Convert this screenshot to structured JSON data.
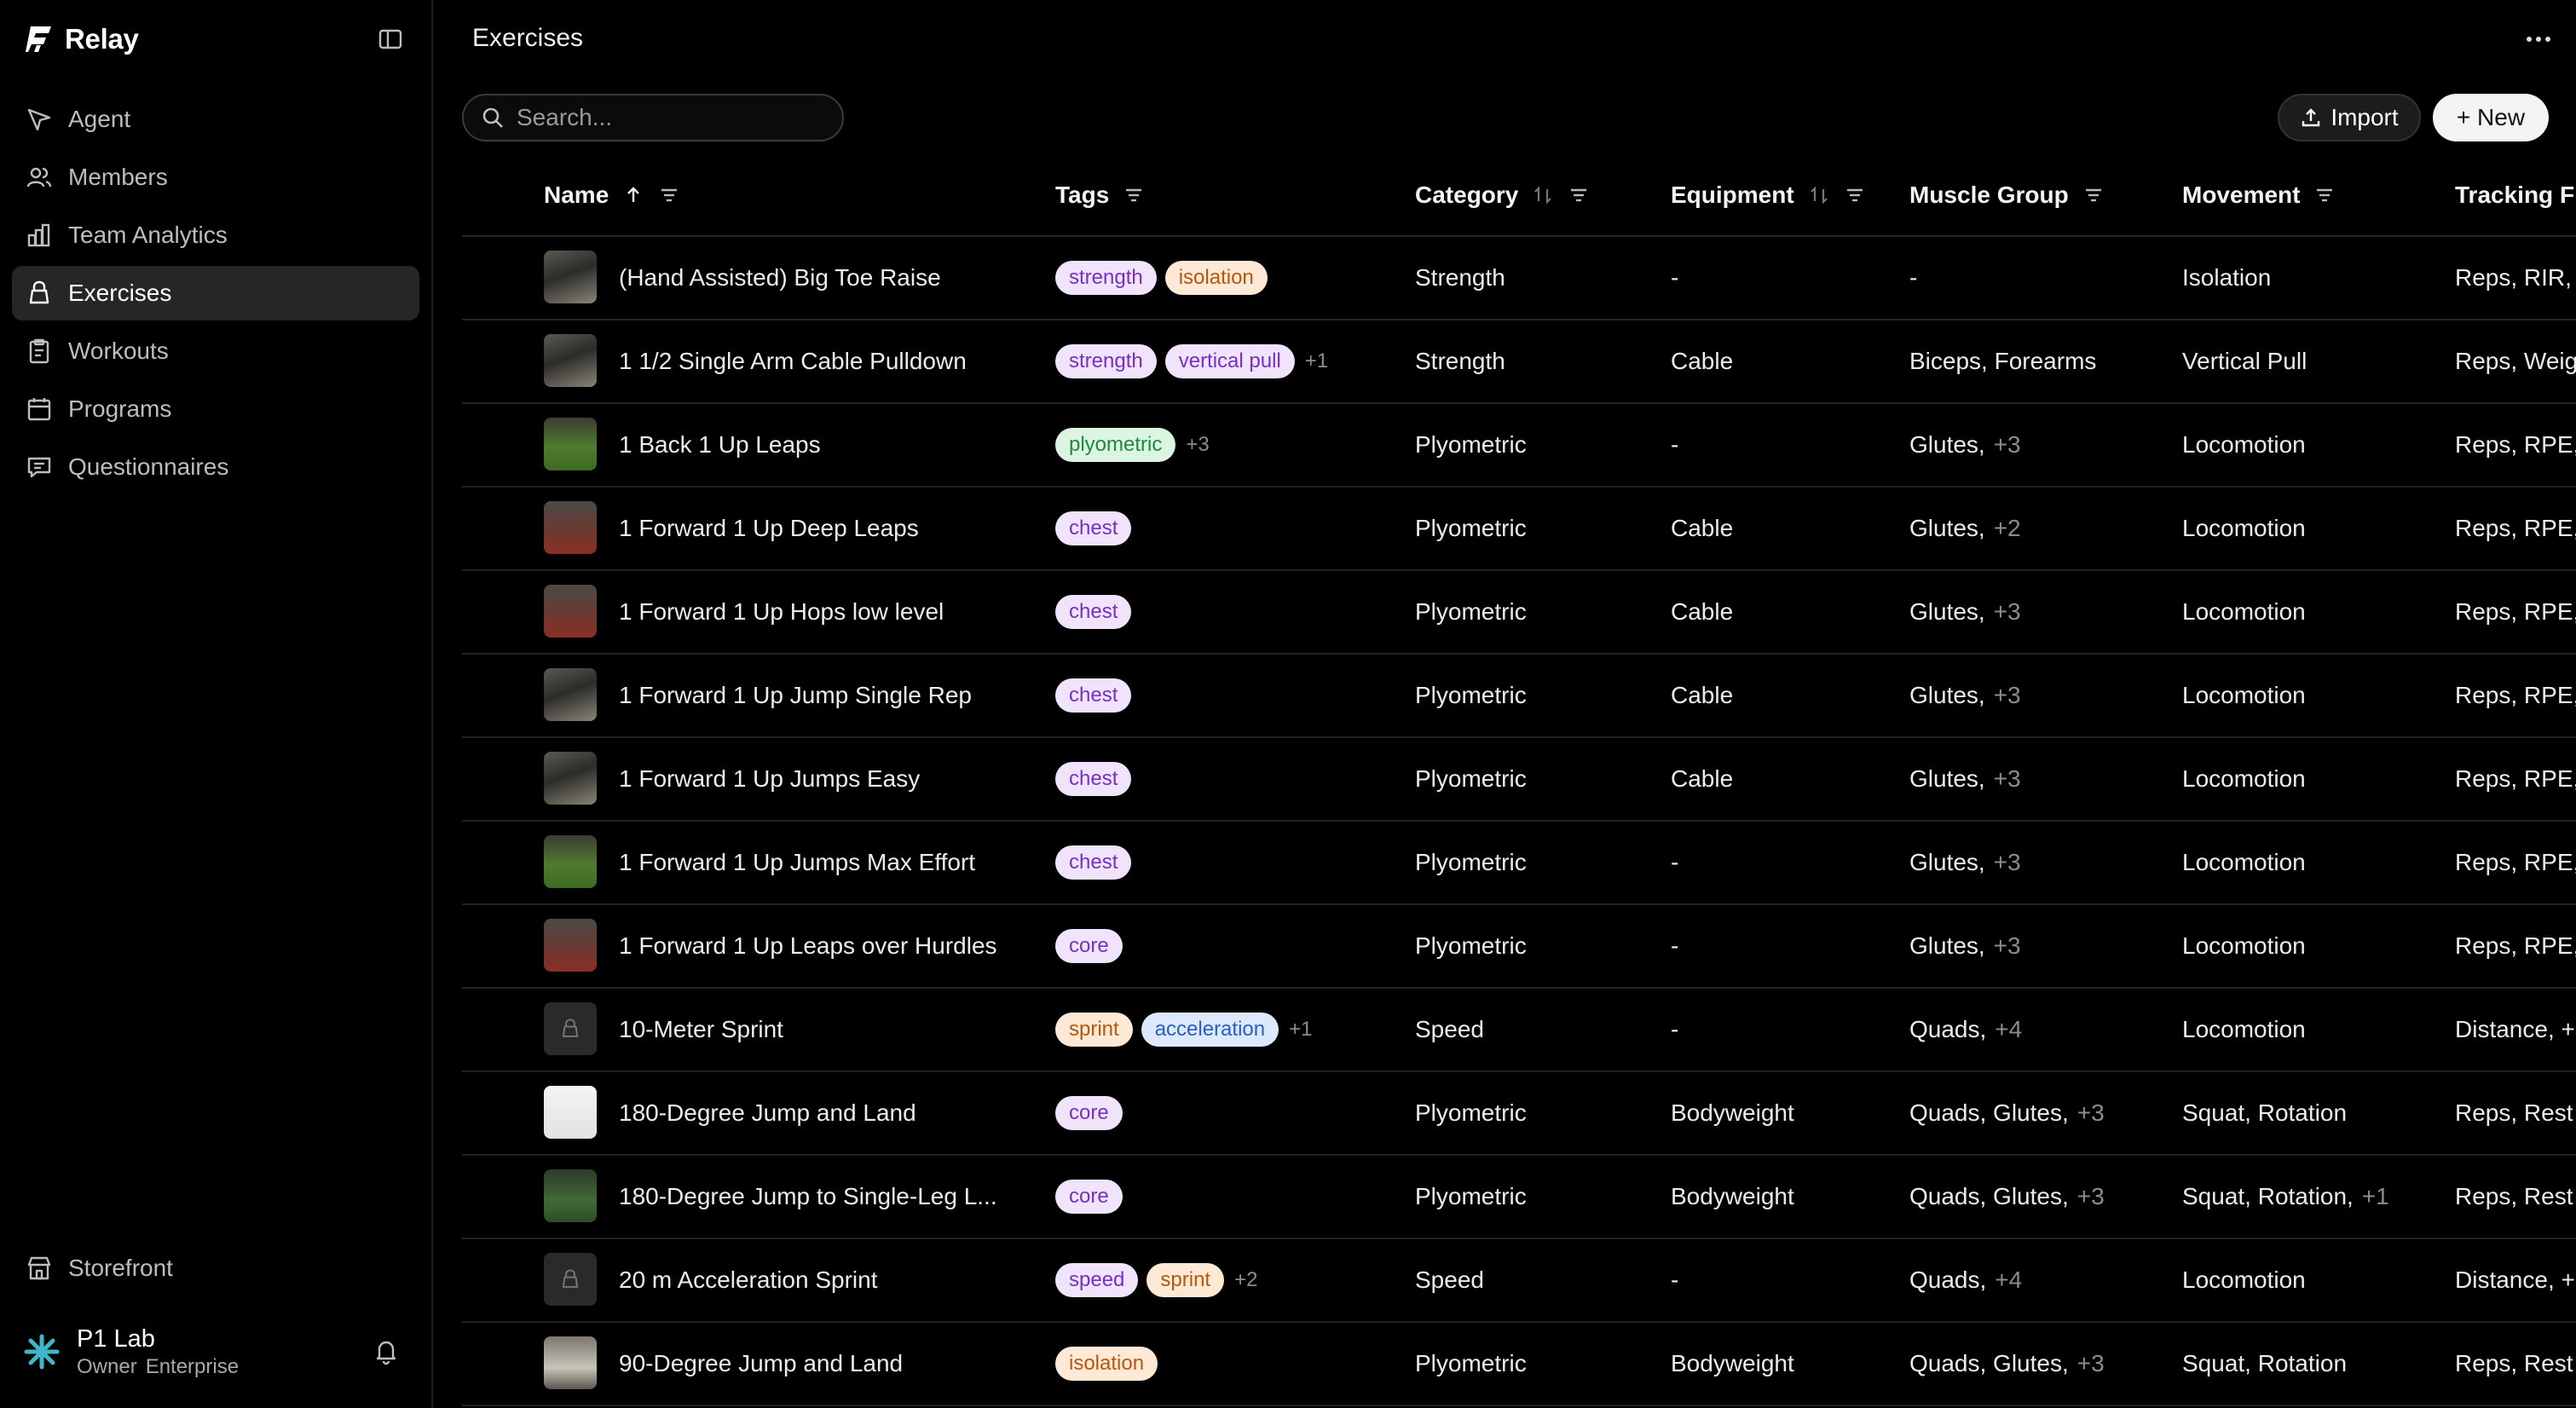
{
  "app": {
    "name": "Relay"
  },
  "nav": {
    "items": [
      {
        "label": "Agent",
        "icon": "send-icon"
      },
      {
        "label": "Members",
        "icon": "users-icon"
      },
      {
        "label": "Team Analytics",
        "icon": "bar-chart-icon"
      },
      {
        "label": "Exercises",
        "icon": "kettlebell-icon",
        "active": true
      },
      {
        "label": "Workouts",
        "icon": "clipboard-icon"
      },
      {
        "label": "Programs",
        "icon": "calendar-icon"
      },
      {
        "label": "Questionnaires",
        "icon": "message-icon"
      }
    ],
    "storefront": "Storefront"
  },
  "account": {
    "name": "P1 Lab",
    "role": "Owner",
    "plan": "Enterprise"
  },
  "page": {
    "title": "Exercises"
  },
  "search": {
    "placeholder": "Search..."
  },
  "toolbar": {
    "import_label": "Import",
    "new_label": "+ New"
  },
  "table": {
    "columns": [
      "Name",
      "Tags",
      "Category",
      "Equipment",
      "Muscle Group",
      "Movement",
      "Tracking F"
    ],
    "rows": [
      {
        "name": "(Hand Assisted) Big Toe Raise",
        "thumb": "photo",
        "tags": [
          "strength",
          "isolation"
        ],
        "more": "",
        "category": "Strength",
        "equipment": "-",
        "muscle": "-",
        "muscle_more": "",
        "movement": "Isolation",
        "movement_more": "",
        "tracking": "Reps, RIR,"
      },
      {
        "name": "1 1/2 Single Arm Cable Pulldown",
        "thumb": "photo",
        "tags": [
          "strength",
          "vertical pull"
        ],
        "more": "+1",
        "category": "Strength",
        "equipment": "Cable",
        "muscle": "Biceps, Forearms",
        "muscle_more": "",
        "movement": "Vertical Pull",
        "movement_more": "",
        "tracking": "Reps, Weig"
      },
      {
        "name": "1 Back 1 Up Leaps",
        "thumb": "grass",
        "tags": [
          "plyometric"
        ],
        "more": "+3",
        "category": "Plyometric",
        "equipment": "-",
        "muscle": "Glutes,",
        "muscle_more": "+3",
        "movement": "Locomotion",
        "movement_more": "",
        "tracking": "Reps, RPE,"
      },
      {
        "name": "1 Forward 1 Up Deep Leaps",
        "thumb": "track",
        "tags": [
          "chest"
        ],
        "more": "",
        "category": "Plyometric",
        "equipment": "Cable",
        "muscle": "Glutes,",
        "muscle_more": "+2",
        "movement": "Locomotion",
        "movement_more": "",
        "tracking": "Reps, RPE,"
      },
      {
        "name": "1 Forward 1 Up Hops low level",
        "thumb": "track",
        "tags": [
          "chest"
        ],
        "more": "",
        "category": "Plyometric",
        "equipment": "Cable",
        "muscle": "Glutes,",
        "muscle_more": "+3",
        "movement": "Locomotion",
        "movement_more": "",
        "tracking": "Reps, RPE,"
      },
      {
        "name": "1 Forward 1 Up Jump Single Rep",
        "thumb": "photo",
        "tags": [
          "chest"
        ],
        "more": "",
        "category": "Plyometric",
        "equipment": "Cable",
        "muscle": "Glutes,",
        "muscle_more": "+3",
        "movement": "Locomotion",
        "movement_more": "",
        "tracking": "Reps, RPE,"
      },
      {
        "name": "1 Forward 1 Up Jumps Easy",
        "thumb": "photo",
        "tags": [
          "chest"
        ],
        "more": "",
        "category": "Plyometric",
        "equipment": "Cable",
        "muscle": "Glutes,",
        "muscle_more": "+3",
        "movement": "Locomotion",
        "movement_more": "",
        "tracking": "Reps, RPE,"
      },
      {
        "name": "1 Forward 1 Up Jumps Max Effort",
        "thumb": "grass",
        "tags": [
          "chest"
        ],
        "more": "",
        "category": "Plyometric",
        "equipment": "-",
        "muscle": "Glutes,",
        "muscle_more": "+3",
        "movement": "Locomotion",
        "movement_more": "",
        "tracking": "Reps, RPE,"
      },
      {
        "name": "1 Forward 1 Up Leaps over Hurdles",
        "thumb": "track",
        "tags": [
          "core"
        ],
        "more": "",
        "category": "Plyometric",
        "equipment": "-",
        "muscle": "Glutes,",
        "muscle_more": "+3",
        "movement": "Locomotion",
        "movement_more": "",
        "tracking": "Reps, RPE,"
      },
      {
        "name": "10-Meter Sprint",
        "thumb": "placeholder",
        "tags": [
          "sprint",
          "acceleration"
        ],
        "more": "+1",
        "category": "Speed",
        "equipment": "-",
        "muscle": "Quads,",
        "muscle_more": "+4",
        "movement": "Locomotion",
        "movement_more": "",
        "tracking": "Distance, +"
      },
      {
        "name": "180-Degree Jump and Land",
        "thumb": "white",
        "tags": [
          "core"
        ],
        "more": "",
        "category": "Plyometric",
        "equipment": "Bodyweight",
        "muscle": "Quads, Glutes,",
        "muscle_more": "+3",
        "movement": "Squat, Rotation",
        "movement_more": "",
        "tracking": "Reps, Rest"
      },
      {
        "name": "180-Degree Jump to Single-Leg L...",
        "thumb": "field",
        "tags": [
          "core"
        ],
        "more": "",
        "category": "Plyometric",
        "equipment": "Bodyweight",
        "muscle": "Quads, Glutes,",
        "muscle_more": "+3",
        "movement": "Squat, Rotation,",
        "movement_more": "+1",
        "tracking": "Reps, Rest"
      },
      {
        "name": "20 m Acceleration Sprint",
        "thumb": "placeholder",
        "tags": [
          "speed",
          "sprint"
        ],
        "more": "+2",
        "category": "Speed",
        "equipment": "-",
        "muscle": "Quads,",
        "muscle_more": "+4",
        "movement": "Locomotion",
        "movement_more": "",
        "tracking": "Distance, +"
      },
      {
        "name": "90-Degree Jump and Land",
        "thumb": "gym",
        "tags": [
          "isolation"
        ],
        "more": "",
        "category": "Plyometric",
        "equipment": "Bodyweight",
        "muscle": "Quads, Glutes,",
        "muscle_more": "+3",
        "movement": "Squat, Rotation",
        "movement_more": "",
        "tracking": "Reps, Rest"
      }
    ]
  },
  "tag_colors": {
    "strength": {
      "bg": "#efe4fb",
      "fg": "#7a2fc4"
    },
    "isolation": {
      "bg": "#fde9d6",
      "fg": "#b8570e"
    },
    "vertical pull": {
      "bg": "#efe4fb",
      "fg": "#7a2fc4"
    },
    "plyometric": {
      "bg": "#dcf5e2",
      "fg": "#1f8a3b"
    },
    "chest": {
      "bg": "#efe4fb",
      "fg": "#7a2fc4"
    },
    "core": {
      "bg": "#efe4fb",
      "fg": "#7a2fc4"
    },
    "sprint": {
      "bg": "#fde9d6",
      "fg": "#b8570e"
    },
    "acceleration": {
      "bg": "#dce8fb",
      "fg": "#2a5fc0"
    },
    "speed": {
      "bg": "#efe4fb",
      "fg": "#7a2fc4"
    }
  }
}
